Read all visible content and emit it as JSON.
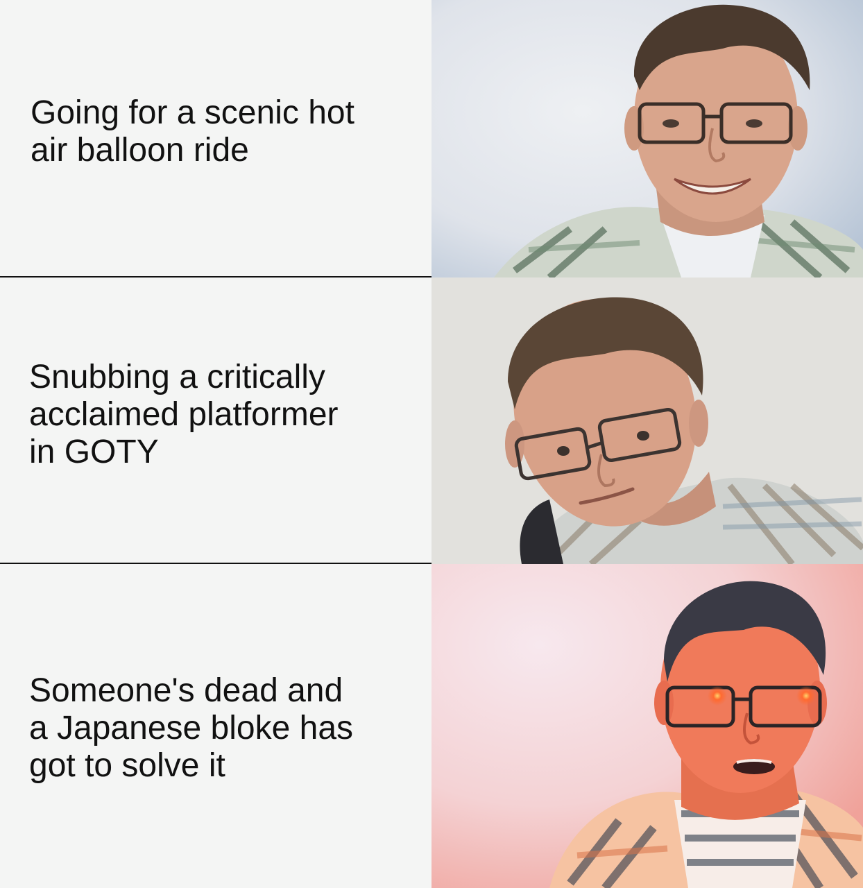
{
  "panels": [
    {
      "caption_lines": [
        "Going for a scenic hot",
        "air balloon ride"
      ],
      "reaction": "smiling man with glasses",
      "palette": {
        "bg_a": "#e9eaee",
        "bg_b": "#b9c6d6",
        "skin": "#d9a58c",
        "hair": "#4b3a2e",
        "shirt": "#cfd3c8",
        "check": "#3f5a45"
      }
    },
    {
      "caption_lines": [
        "Snubbing a critically",
        "acclaimed platformer",
        "in GOTY"
      ],
      "reaction": "skeptical side-eye man with glasses",
      "palette": {
        "bg_a": "#ecebe8",
        "bg_b": "#d7d4cf",
        "skin": "#d8a188",
        "hair": "#5a4636",
        "shirt": "#cfd2cf",
        "check": "#8a7a66"
      }
    },
    {
      "caption_lines": [
        "Someone's dead and",
        "a Japanese bloke has",
        "got to solve it"
      ],
      "reaction": "excited glowing-eyed man with glasses",
      "palette": {
        "bg_a": "#f6e6ec",
        "bg_b": "#f2a7a0",
        "skin": "#f07a5a",
        "hair": "#3a3a45",
        "shirt": "#f7c7a8",
        "check": "#2f3a4a",
        "eye_glow": "#ff5a2a"
      }
    }
  ]
}
